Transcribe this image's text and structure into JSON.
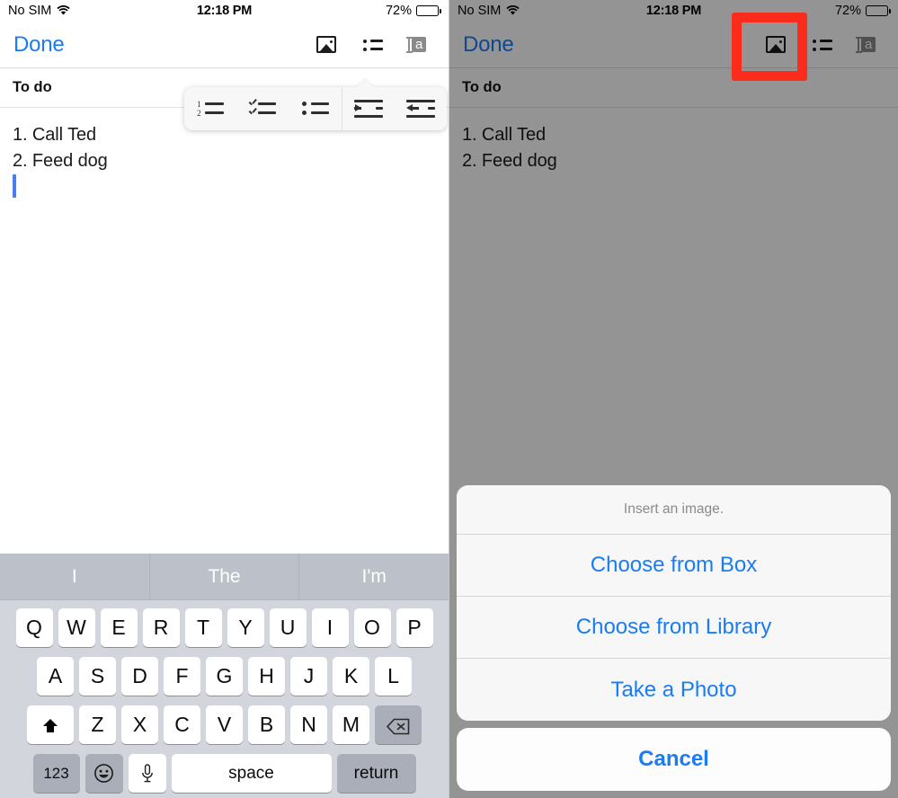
{
  "status_bar": {
    "carrier": "No SIM",
    "wifi_icon": "wifi-icon",
    "time": "12:18 PM",
    "battery_percent": "72%",
    "battery_level": 72
  },
  "navbar": {
    "done_label": "Done",
    "tools": [
      {
        "name": "insert-image-icon",
        "label": "Insert image"
      },
      {
        "name": "list-format-icon",
        "label": "List formatting"
      },
      {
        "name": "text-format-icon",
        "label": "Text formatting"
      }
    ]
  },
  "document": {
    "header": "To do",
    "lines": [
      "1. Call Ted",
      "2. Feed dog"
    ]
  },
  "list_popup": {
    "items": [
      {
        "name": "numbered-list-icon",
        "label": "Numbered list"
      },
      {
        "name": "checklist-icon",
        "label": "Checklist"
      },
      {
        "name": "bullet-list-icon",
        "label": "Bullet list"
      },
      {
        "name": "indent-icon",
        "label": "Increase indent"
      },
      {
        "name": "outdent-icon",
        "label": "Decrease indent"
      }
    ]
  },
  "keyboard": {
    "predictions": [
      "I",
      "The",
      "I'm"
    ],
    "row1": [
      "Q",
      "W",
      "E",
      "R",
      "T",
      "Y",
      "U",
      "I",
      "O",
      "P"
    ],
    "row2": [
      "A",
      "S",
      "D",
      "F",
      "G",
      "H",
      "J",
      "K",
      "L"
    ],
    "row3": [
      "Z",
      "X",
      "C",
      "V",
      "B",
      "N",
      "M"
    ],
    "shift_icon": "shift-icon",
    "backspace_icon": "backspace-icon",
    "numbers_label": "123",
    "emoji_icon": "emoji-icon",
    "mic_icon": "microphone-icon",
    "space_label": "space",
    "return_label": "return"
  },
  "action_sheet": {
    "title": "Insert an image.",
    "options": [
      "Choose from Box",
      "Choose from Library",
      "Take a Photo"
    ],
    "cancel_label": "Cancel"
  },
  "annotation": {
    "highlight_color": "#fb2c1c",
    "highlight_target": "insert-image-icon"
  },
  "colors": {
    "accent_blue": "#1a7cf5",
    "caret_blue": "#4a7ef0",
    "keyboard_bg": "#d2d5db",
    "prediction_bg": "#bcc0c8"
  }
}
